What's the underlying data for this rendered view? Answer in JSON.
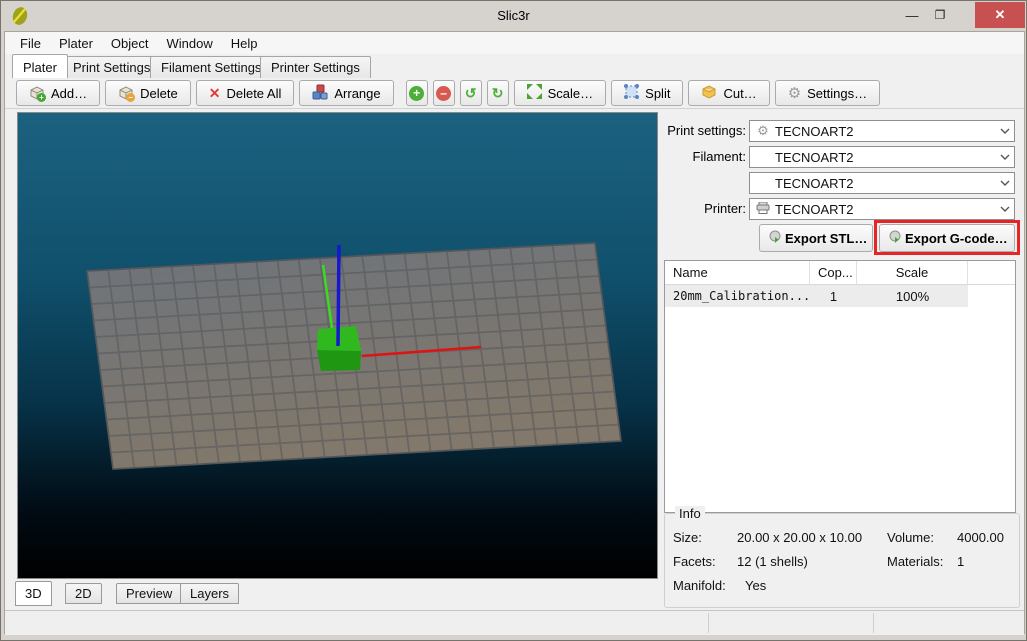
{
  "window": {
    "title": "Slic3r"
  },
  "titlebar": {
    "minimize_glyph": "—",
    "maximize_glyph": "❐",
    "close_glyph": "✕"
  },
  "menu": {
    "items": [
      "File",
      "Plater",
      "Object",
      "Window",
      "Help"
    ]
  },
  "tabs": {
    "items": [
      "Plater",
      "Print Settings",
      "Filament Settings",
      "Printer Settings"
    ],
    "active": "Plater"
  },
  "toolbar": {
    "add_label": "Add…",
    "delete_label": "Delete",
    "delete_all_label": "Delete All",
    "arrange_label": "Arrange",
    "scale_label": "Scale…",
    "split_label": "Split",
    "cut_label": "Cut…",
    "settings_label": "Settings…"
  },
  "right_panel": {
    "print_settings_label": "Print settings:",
    "filament_label": "Filament:",
    "printer_label": "Printer:",
    "print_settings_value": "TECNOART2",
    "filament_value_1": "TECNOART2",
    "filament_value_2": "TECNOART2",
    "printer_value": "TECNOART2",
    "export_stl_label": "Export STL…",
    "export_gcode_label": "Export G-code…",
    "annotation_color": "#e62626"
  },
  "object_table": {
    "columns": [
      "Name",
      "Cop...",
      "Scale"
    ],
    "rows": [
      {
        "name": "20mm_Calibration...",
        "copies": "1",
        "scale": "100%"
      }
    ]
  },
  "info": {
    "legend": "Info",
    "size_label": "Size:",
    "size_value": "20.00 x 20.00 x 10.00",
    "volume_label": "Volume:",
    "volume_value": "4000.00",
    "facets_label": "Facets:",
    "facets_value": "12 (1 shells)",
    "materials_label": "Materials:",
    "materials_value": "1",
    "manifold_label": "Manifold:",
    "manifold_value": "Yes"
  },
  "view_tabs": {
    "items": [
      "3D",
      "2D",
      "Preview",
      "Layers"
    ],
    "active": "3D"
  },
  "scene": {
    "background_top": "#1b6280",
    "background_bottom": "#000000",
    "platform_top_color": "#6f747a",
    "platform_bottom_color": "#82786b",
    "grid_line_color": "#54575a",
    "cube_top_color": "#2fb91f",
    "cube_front_color": "#1f9712",
    "axis_x_color": "#dd1414",
    "axis_y_color": "#39dd1d",
    "axis_z_color": "#1717cf"
  }
}
